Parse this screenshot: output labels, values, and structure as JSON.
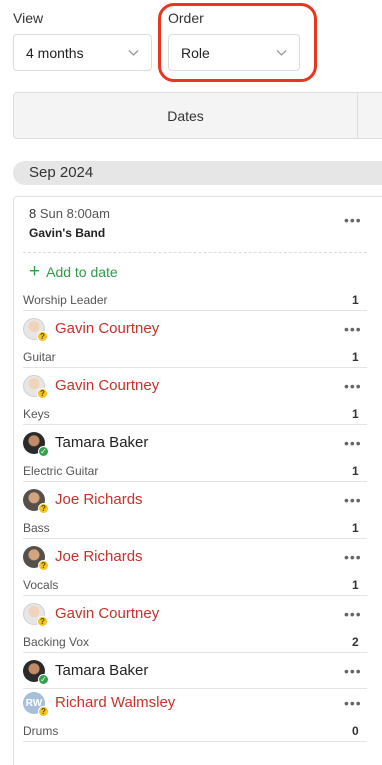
{
  "filters": {
    "view_label": "View",
    "view_value": "4 months",
    "order_label": "Order",
    "order_value": "Role"
  },
  "tabs": {
    "dates": "Dates"
  },
  "month": "Sep 2024",
  "plan": {
    "day": "8",
    "when": "Sun 8:00am",
    "name": "Gavin's Band",
    "add_label": "Add to date"
  },
  "roles": [
    {
      "role": "Worship Leader",
      "count": "1",
      "people": [
        {
          "name": "Gavin Courtney",
          "status": "unconfirmed"
        }
      ]
    },
    {
      "role": "Guitar",
      "count": "1",
      "people": [
        {
          "name": "Gavin Courtney",
          "status": "unconfirmed"
        }
      ]
    },
    {
      "role": "Keys",
      "count": "1",
      "people": [
        {
          "name": "Tamara Baker",
          "status": "confirmed"
        }
      ]
    },
    {
      "role": "Electric Guitar",
      "count": "1",
      "people": [
        {
          "name": "Joe Richards",
          "status": "unconfirmed"
        }
      ]
    },
    {
      "role": "Bass",
      "count": "1",
      "people": [
        {
          "name": "Joe Richards",
          "status": "unconfirmed"
        }
      ]
    },
    {
      "role": "Vocals",
      "count": "1",
      "people": [
        {
          "name": "Gavin Courtney",
          "status": "unconfirmed"
        }
      ]
    },
    {
      "role": "Backing Vox",
      "count": "2",
      "people": [
        {
          "name": "Tamara Baker",
          "status": "confirmed"
        },
        {
          "name": "Richard Walmsley",
          "status": "unconfirmed",
          "initials": "RW"
        }
      ]
    },
    {
      "role": "Drums",
      "count": "0",
      "people": []
    }
  ],
  "icons": {
    "select_chevron": "chevron-down-icon",
    "more": "more-horizontal-icon",
    "add": "plus-icon",
    "unconfirmed_badge": "question-badge-icon",
    "confirmed_badge": "check-badge-icon"
  },
  "colors": {
    "accent_green": "#2d9b48",
    "pending_red": "#c8312b",
    "highlight_ring": "#e8361f",
    "badge_yellow": "#f3c41b",
    "badge_green": "#31a24c"
  },
  "glyphs": {
    "more": "•••",
    "plus": "+",
    "q": "?",
    "ok": "✓"
  }
}
